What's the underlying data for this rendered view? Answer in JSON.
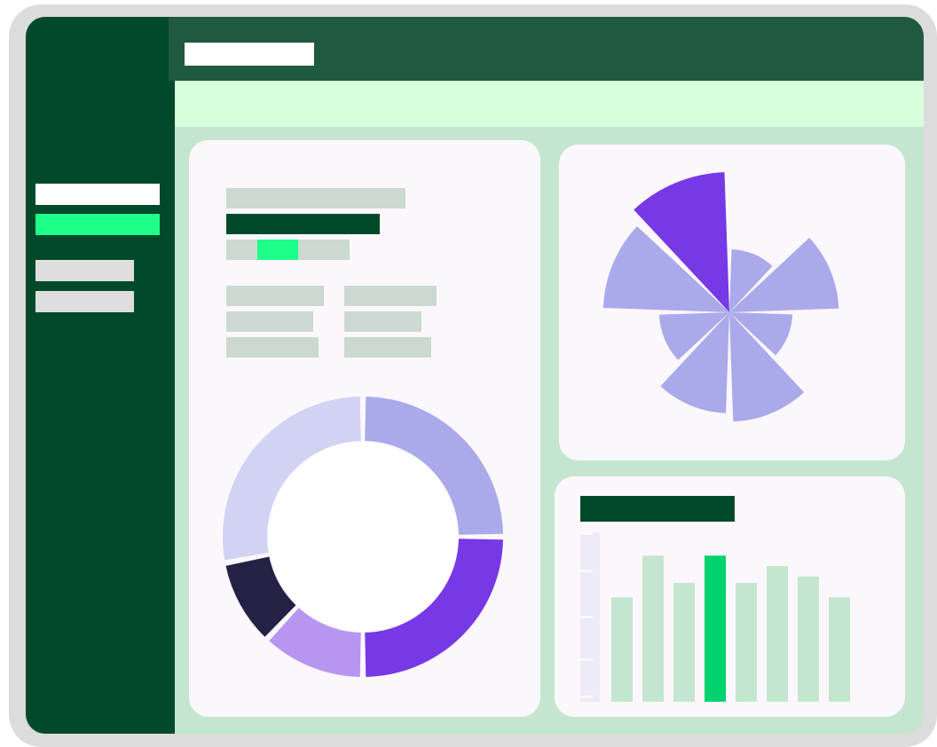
{
  "app": {
    "title_pill": "",
    "colors": {
      "frame": "#dcdcdc",
      "sidebar": "#004a2b",
      "topbar": "#1f5a40",
      "subbar": "#d6ffdc",
      "background": "#c4e6cf",
      "card": "#fcf7fc",
      "accent": "#1dff8a",
      "placeholder": "#cbd9d0"
    }
  },
  "sidebar": {
    "items": [
      {
        "label": "",
        "state": "default"
      },
      {
        "label": "",
        "state": "active"
      },
      {
        "label": "",
        "state": "default"
      },
      {
        "label": "",
        "state": "default"
      }
    ]
  },
  "summary_card": {
    "heading": "",
    "title": "",
    "progress_fraction": 0.33,
    "stats": [
      {
        "label": "",
        "value": ""
      },
      {
        "label": "",
        "value": ""
      },
      {
        "label": "",
        "value": ""
      }
    ]
  },
  "chart_data": [
    {
      "type": "pie",
      "variant": "donut",
      "slices": [
        {
          "value": 25,
          "color": "#aaa9ea"
        },
        {
          "value": 25,
          "color": "#7738e6"
        },
        {
          "value": 12,
          "color": "#b796f1"
        },
        {
          "value": 10,
          "color": "#232245"
        },
        {
          "value": 28,
          "color": "#d2d2f3"
        }
      ]
    },
    {
      "type": "pie",
      "variant": "polar-area",
      "slices": [
        {
          "value": 100,
          "color": "#7738e6"
        },
        {
          "value": 45,
          "color": "#aaa9ea"
        },
        {
          "value": 78,
          "color": "#aaa9ea"
        },
        {
          "value": 45,
          "color": "#aaa9ea"
        },
        {
          "value": 78,
          "color": "#aaa9ea"
        },
        {
          "value": 72,
          "color": "#aaa9ea"
        },
        {
          "value": 50,
          "color": "#aaa9ea"
        },
        {
          "value": 90,
          "color": "#aaa9ea"
        }
      ]
    },
    {
      "type": "bar",
      "title": "",
      "values": [
        50,
        70,
        57,
        70,
        57,
        65,
        60,
        50
      ],
      "highlight_index": 3,
      "bar_color": "#c4e6cf",
      "highlight_color": "#00d36e",
      "ylim": [
        0,
        85
      ]
    }
  ]
}
